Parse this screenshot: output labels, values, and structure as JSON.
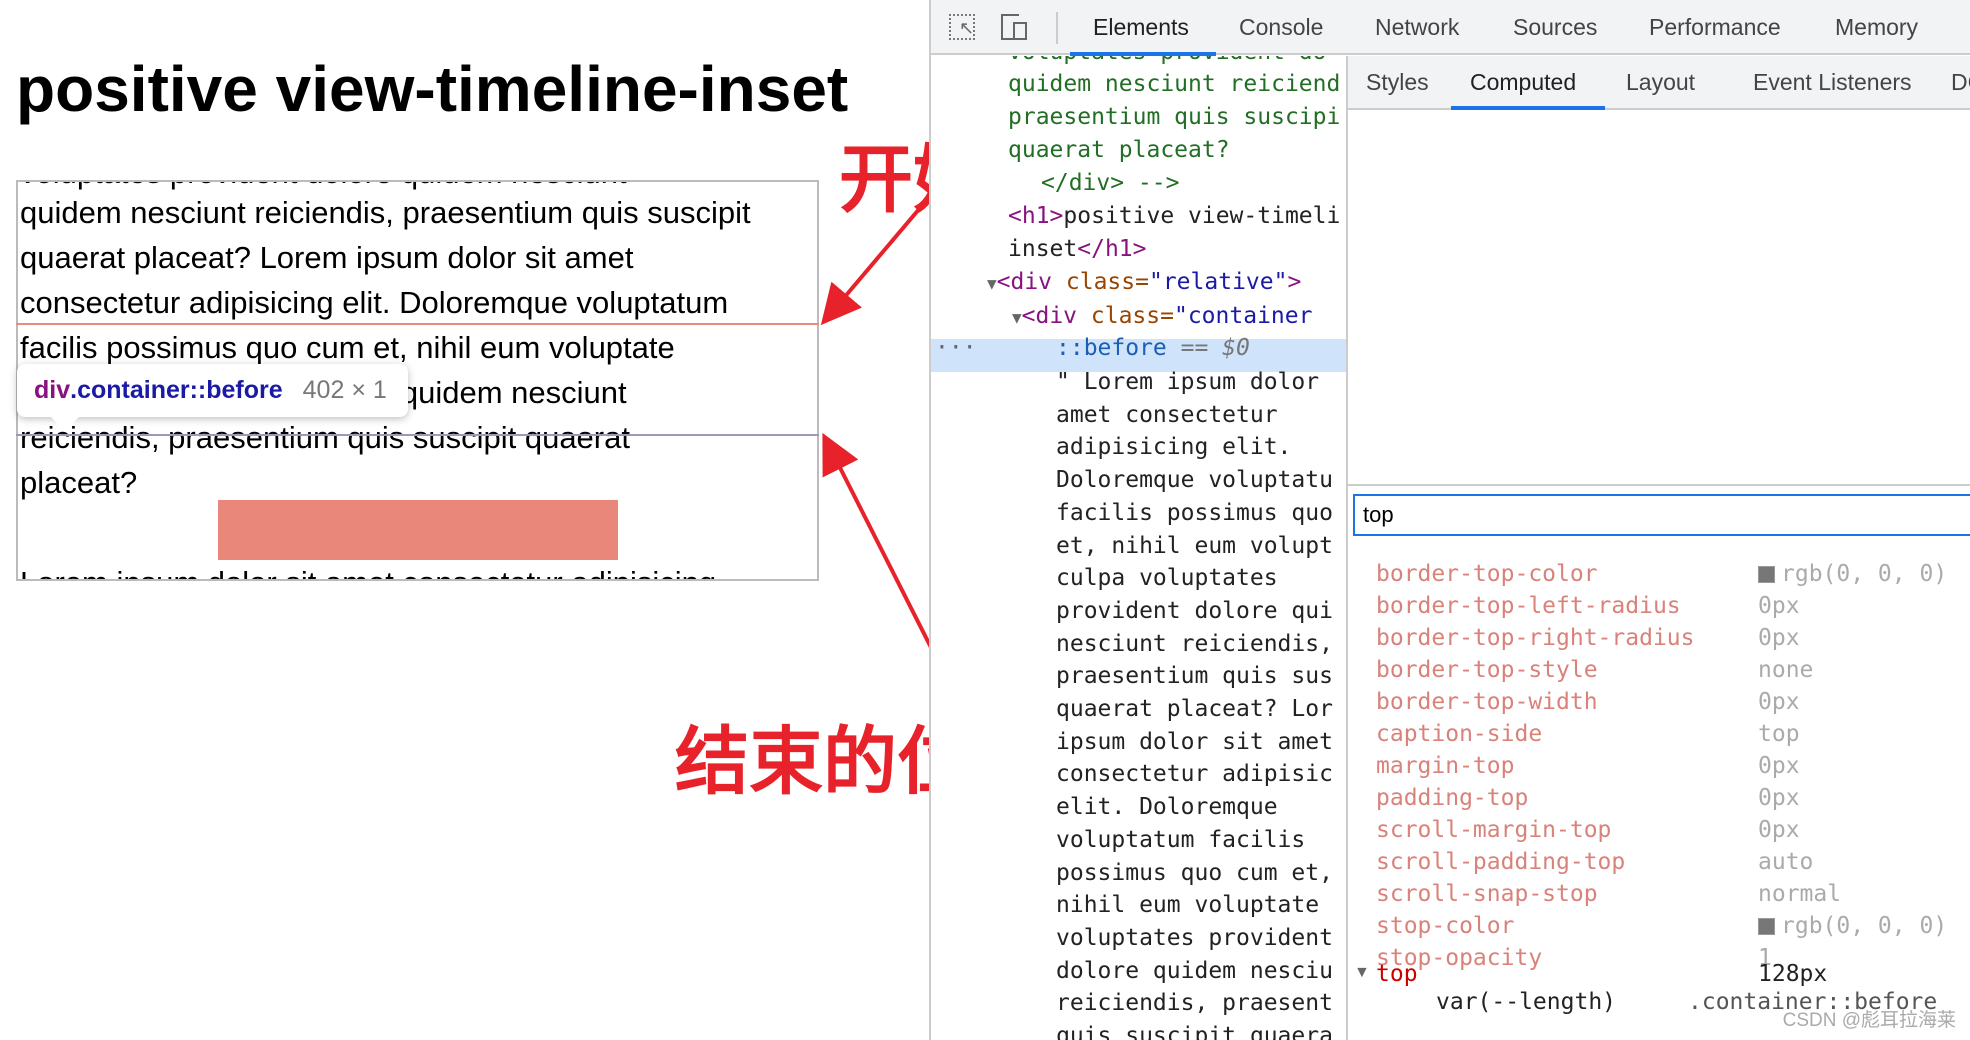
{
  "page": {
    "title": "positive view-timeline-inset",
    "paragraph_lines": [
      "quidem nesciunt reiciendis, praesentium quis suscipit",
      "quaerat placeat? Lorem ipsum dolor sit amet",
      "consectetur adipisicing elit. Doloremque voluptatum",
      "facilis possimus quo cum et, nihil eum voluptate",
      "voluptates provident dolore quidem nesciunt",
      "reiciendis, praesentium quis suscipit quaerat",
      "placeat?",
      "Lorem ipsum dolor sit amet consectetur adipisicing"
    ],
    "tooltip": {
      "element": "div",
      "class": ".container::before",
      "size": "402 × 1"
    },
    "annotations": {
      "start": "开始位置",
      "end": "结束的位置"
    },
    "colors": {
      "annotation": "#e8222a",
      "block": "#e8877a",
      "start_line": "#e88a7c",
      "end_line": "#9a9ab8"
    }
  },
  "devtools": {
    "tabs": [
      "Elements",
      "Console",
      "Network",
      "Sources",
      "Performance",
      "Memory"
    ],
    "active_tab": "Elements",
    "icons": [
      "inspect-element-icon",
      "device-toolbar-icon"
    ],
    "elements_lines": [
      {
        "cls": "green",
        "text": "voluptates provident do"
      },
      {
        "cls": "green",
        "text": "quidem nesciunt reiciend"
      },
      {
        "cls": "green",
        "text": "praesentium quis suscipi"
      },
      {
        "cls": "green",
        "text": "quaerat placeat?"
      },
      {
        "cls": "green",
        "text": "</div> -->"
      }
    ],
    "h1_open": "<h1>",
    "h1_text_1": "positive view-timeli",
    "h1_text_2": "inset",
    "h1_close": "</h1>",
    "div_relative": {
      "open": "<div ",
      "attr": "class=",
      "val": "\"relative\"",
      "close": ">"
    },
    "div_container": {
      "open": "<div ",
      "attr": "class=",
      "val": "\"container"
    },
    "selected": {
      "text": "::before",
      "eq": " == $0"
    },
    "text_node_lines": [
      "\" Lorem ipsum dolor",
      "amet consectetur",
      "adipisicing elit.",
      "Doloremque voluptatu",
      "facilis possimus quo",
      "et, nihil eum volupt",
      "culpa voluptates",
      "provident dolore qui",
      "nesciunt reiciendis,",
      "praesentium quis sus",
      "quaerat placeat? Lor",
      "ipsum dolor sit amet",
      "consectetur adipisic",
      "elit. Doloremque",
      "voluptatum facilis",
      "possimus quo cum et,",
      "nihil eum voluptate",
      "voluptates provident",
      "dolore quidem nesciu",
      "reiciendis, praesent",
      "quis suscipit quaera"
    ],
    "sidebar_tabs": [
      "Styles",
      "Computed",
      "Layout",
      "Event Listeners",
      "DC"
    ],
    "active_sidebar_tab": "Computed",
    "filter_value": "top",
    "computed": [
      {
        "name": "border-top-color",
        "value": "rgb(0, 0, 0)",
        "swatch": true
      },
      {
        "name": "border-top-left-radius",
        "value": "0px"
      },
      {
        "name": "border-top-right-radius",
        "value": "0px"
      },
      {
        "name": "border-top-style",
        "value": "none"
      },
      {
        "name": "border-top-width",
        "value": "0px"
      },
      {
        "name": "caption-side",
        "value": "top"
      },
      {
        "name": "margin-top",
        "value": "0px"
      },
      {
        "name": "padding-top",
        "value": "0px"
      },
      {
        "name": "scroll-margin-top",
        "value": "0px"
      },
      {
        "name": "scroll-padding-top",
        "value": "auto"
      },
      {
        "name": "scroll-snap-stop",
        "value": "normal"
      },
      {
        "name": "stop-color",
        "value": "rgb(0, 0, 0)",
        "swatch": true
      },
      {
        "name": "stop-opacity",
        "value": "1"
      }
    ],
    "expanded": {
      "name": "top",
      "value": "128px",
      "source_value": "var(--length)",
      "selector": ".container::before"
    }
  },
  "watermark": "CSDN @彪耳拉海莱"
}
